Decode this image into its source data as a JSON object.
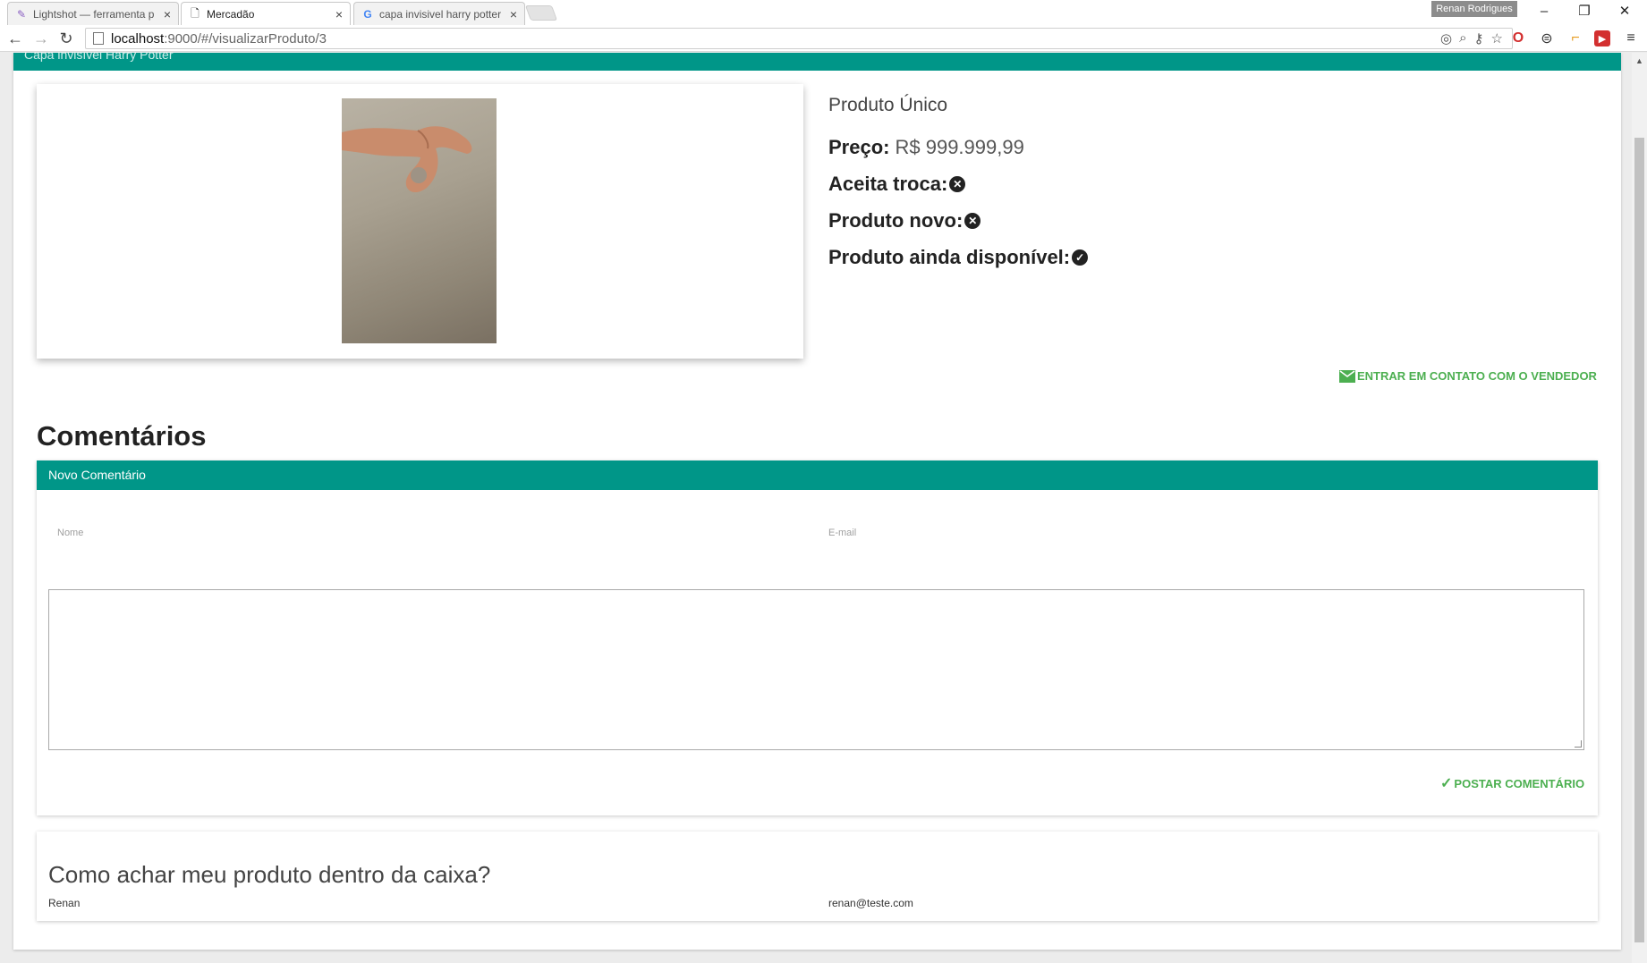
{
  "browser": {
    "tabs": [
      {
        "label": "Lightshot — ferramenta p",
        "icon": "feather-icon",
        "active": false
      },
      {
        "label": "Mercadão",
        "icon": "page-icon",
        "active": true
      },
      {
        "label": "capa invisivel harry potter",
        "icon": "google-icon",
        "active": false
      }
    ],
    "profile": "Renan Rodrigues",
    "url_host": "localhost",
    "url_path": ":9000/#/visualizarProduto/3"
  },
  "page": {
    "header_title": "Capa invisível Harry Potter"
  },
  "product": {
    "name": "Produto Único",
    "price_label": "Preço:",
    "price_value": "R$ 999.999,99",
    "exchange_label": "Aceita troca:",
    "exchange_value": false,
    "new_label": "Produto novo:",
    "new_value": false,
    "available_label": "Produto ainda disponível:",
    "available_value": true,
    "contact_label": "ENTRAR EM CONTATO COM O VENDEDOR"
  },
  "comments": {
    "title": "Comentários",
    "new_comment": {
      "header": "Novo Comentário",
      "name_label": "Nome",
      "email_label": "E-mail",
      "post_label": "POSTAR COMENTÁRIO"
    },
    "list": [
      {
        "text": "Como achar meu produto dentro da caixa?",
        "author": "Renan",
        "email": "renan@teste.com"
      }
    ]
  },
  "colors": {
    "accent": "#009688",
    "action": "#4caf50"
  }
}
